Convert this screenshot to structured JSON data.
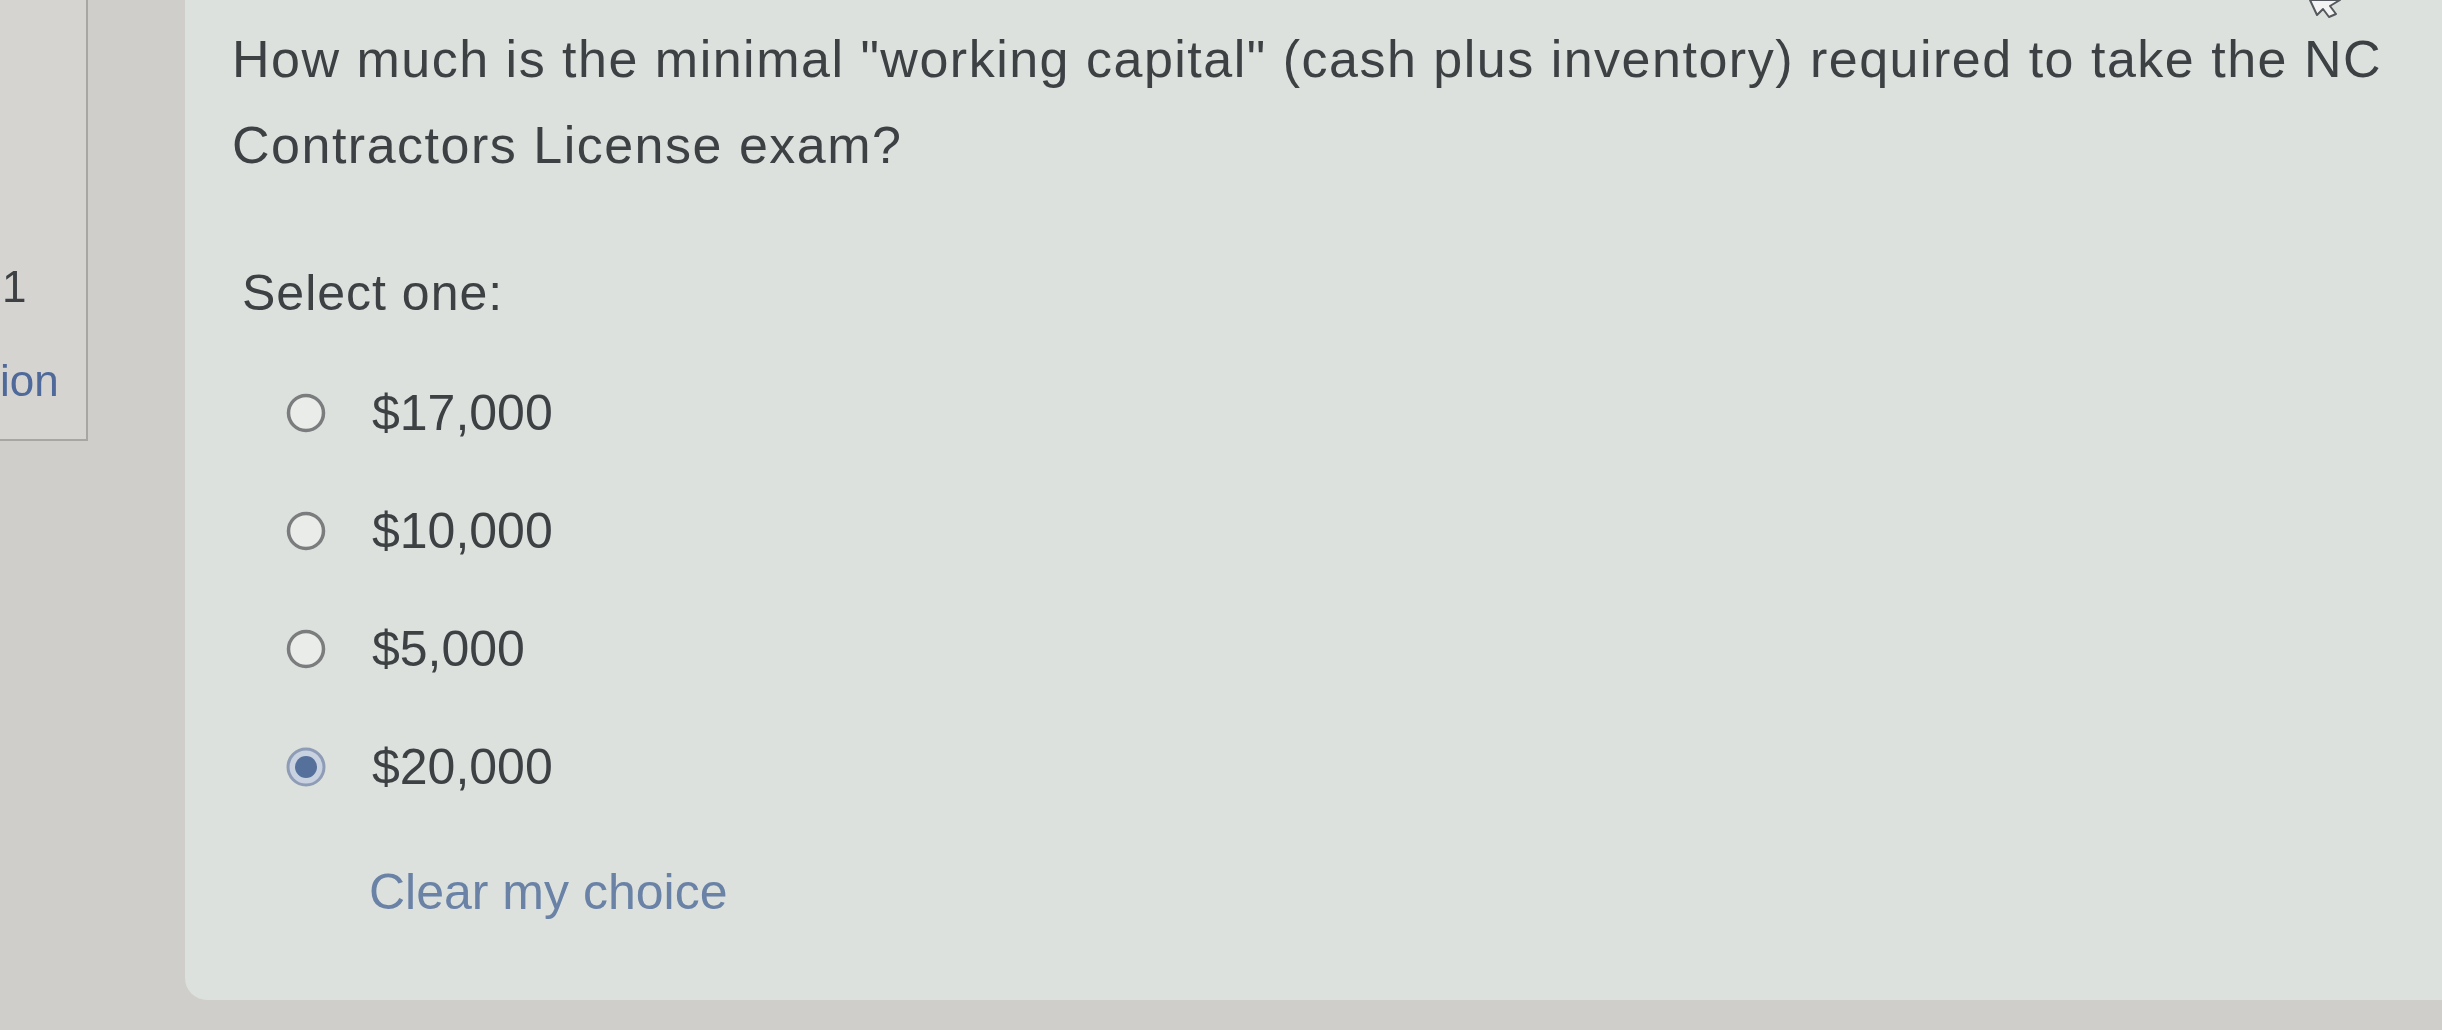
{
  "question_info": {
    "number": "1",
    "link": "ion"
  },
  "question": {
    "text": "How much is the minimal \"working capital\" (cash plus inventory) required to take the NC Contractors License exam?",
    "prompt": "Select one:",
    "options": [
      {
        "label": "$17,000",
        "selected": false
      },
      {
        "label": "$10,000",
        "selected": false
      },
      {
        "label": "$5,000",
        "selected": false
      },
      {
        "label": "$20,000",
        "selected": true
      }
    ],
    "clear_link": "Clear my choice"
  }
}
